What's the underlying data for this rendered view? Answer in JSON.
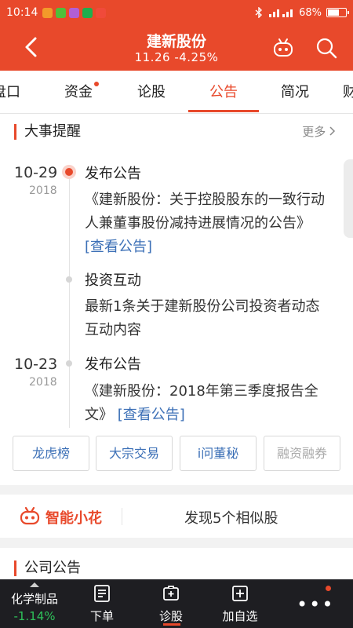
{
  "status_bar": {
    "time": "10:14",
    "battery": "68%",
    "battery_level": 0.68
  },
  "header": {
    "title": "建新股份",
    "price": "11.26",
    "change": "-4.25%"
  },
  "tabs": [
    {
      "label": "盘口"
    },
    {
      "label": "资金"
    },
    {
      "label": "论股"
    },
    {
      "label": "公告"
    },
    {
      "label": "简况"
    },
    {
      "label": "财"
    }
  ],
  "events": {
    "title": "大事提醒",
    "more": "更多",
    "items": [
      {
        "date": "10-29",
        "year": "2018",
        "type": "发布公告",
        "text": "《建新股份：关于控股股东的一致行动人兼董事股份减持进展情况的公告》",
        "link": "[查看公告]"
      },
      {
        "type": "投资互动",
        "text": "最新1条关于建新股份公司投资者动态互动内容"
      },
      {
        "date": "10-23",
        "year": "2018",
        "type": "发布公告",
        "text": "《建新股份：2018年第三季度报告全文》",
        "link": "[查看公告]"
      }
    ]
  },
  "quick_buttons": [
    {
      "label": "龙虎榜"
    },
    {
      "label": "大宗交易"
    },
    {
      "label": "i问董秘"
    },
    {
      "label": "融资融券"
    }
  ],
  "smart": {
    "label": "智能小花",
    "message": "发现5个相似股"
  },
  "company": {
    "title": "公司公告"
  },
  "bottom_nav": {
    "stock_name": "化学制品",
    "stock_change": "-1.14%",
    "items": [
      {
        "label": "下单"
      },
      {
        "label": "诊股"
      },
      {
        "label": "加自选"
      }
    ],
    "more": "•••"
  },
  "colors": {
    "brand": "#e8492b",
    "link": "#3b6fb6",
    "down": "#2fc15a"
  }
}
